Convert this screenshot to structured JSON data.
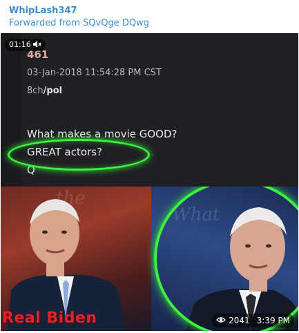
{
  "message": {
    "sender": "WhipLash347",
    "forwarded_prefix": "Forwarded from",
    "forwarded_from": "SQvQge DQwg"
  },
  "video": {
    "duration": "01:16",
    "views": "2041",
    "time": "3:39 PM"
  },
  "post": {
    "number": "461",
    "date": "03-Jan-2018 11:54:28 PM CST",
    "board_prefix": "8ch",
    "board": "/pol",
    "line1": "What makes a movie GOOD?",
    "line2": "GREAT actors?",
    "line3": "Q"
  },
  "caption": {
    "text": "Real Biden"
  },
  "colors": {
    "link": "#3a8fd4",
    "highlight": "#3df23d",
    "caption": "#e0242a"
  },
  "icons": {
    "mute": "speaker-muted-icon",
    "views": "eye-icon"
  }
}
